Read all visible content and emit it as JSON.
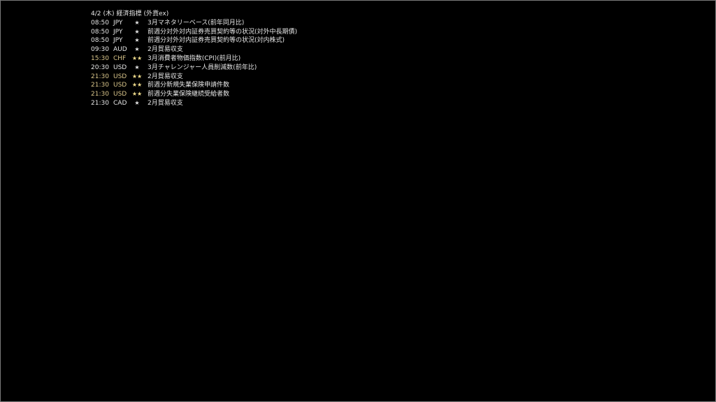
{
  "header": {
    "date": "4/2",
    "weekday": "(木)",
    "title": "経済指標",
    "source": "(外貨ex)"
  },
  "colors": {
    "background": "#000000",
    "text": "#e6e6e6",
    "highlight": "#d9c58a",
    "star_highlight": "#f0dc8c",
    "border": "#7a7a7a"
  },
  "events": [
    {
      "time": "08:50",
      "currency": "JPY",
      "stars": "★",
      "event": "3月マネタリーベース(前年同月比)",
      "level": 1
    },
    {
      "time": "08:50",
      "currency": "JPY",
      "stars": "★",
      "event": "前週分対外対内証券売買契約等の状況(対外中長期債)",
      "level": 1
    },
    {
      "time": "08:50",
      "currency": "JPY",
      "stars": "★",
      "event": "前週分対外対内証券売買契約等の状況(対内株式)",
      "level": 1
    },
    {
      "time": "09:30",
      "currency": "AUD",
      "stars": "★",
      "event": "2月貿易収支",
      "level": 1
    },
    {
      "time": "15:30",
      "currency": "CHF",
      "stars": "★★",
      "event": "3月消費者物価指数(CPI)(前月比)",
      "level": 2
    },
    {
      "time": "20:30",
      "currency": "USD",
      "stars": "★",
      "event": "3月チャレンジャー人員削減数(前年比)",
      "level": 1
    },
    {
      "time": "21:30",
      "currency": "USD",
      "stars": "★★",
      "event": "2月貿易収支",
      "level": 2
    },
    {
      "time": "21:30",
      "currency": "USD",
      "stars": "★★",
      "event": "前週分新規失業保険申請件数",
      "level": 2
    },
    {
      "time": "21:30",
      "currency": "USD",
      "stars": "★★",
      "event": "前週分失業保険継続受給者数",
      "level": 2
    },
    {
      "time": "21:30",
      "currency": "CAD",
      "stars": "★",
      "event": "2月貿易収支",
      "level": 1
    }
  ]
}
